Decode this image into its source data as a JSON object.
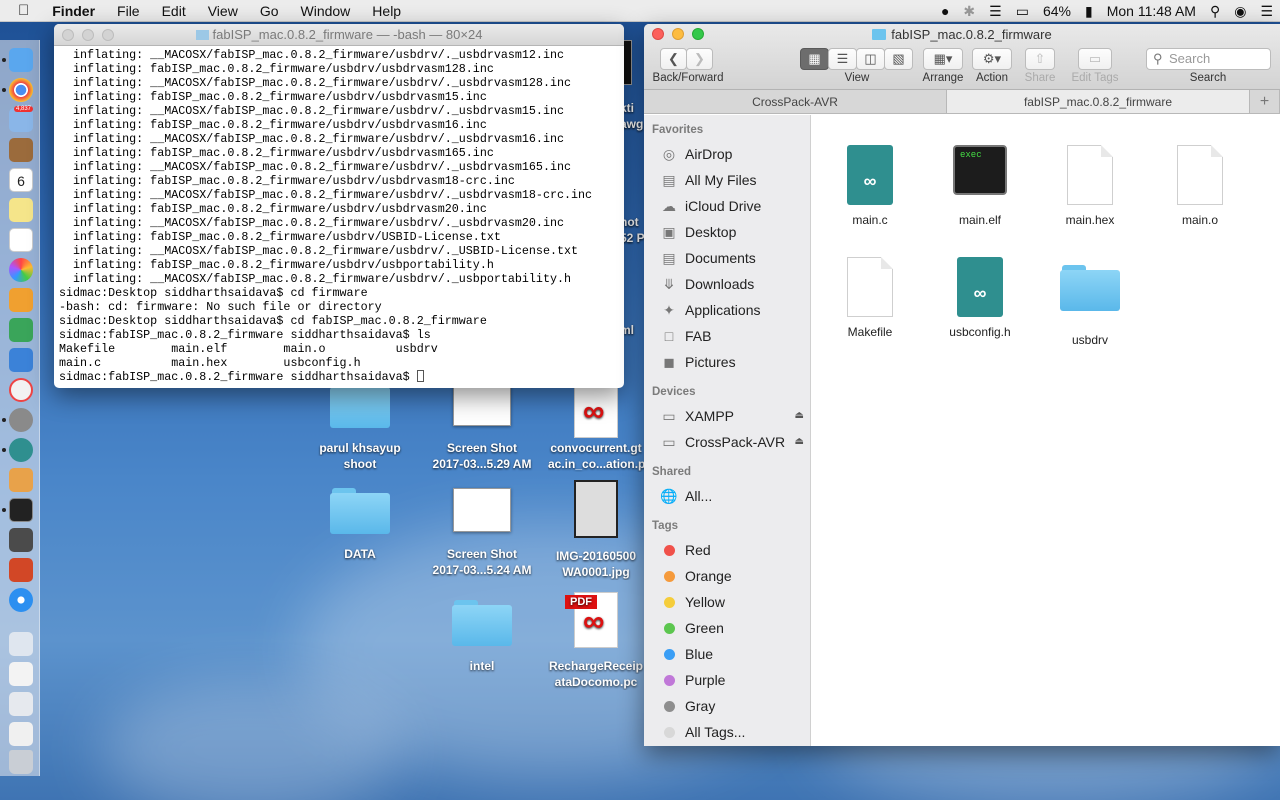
{
  "menubar": {
    "apple_icon": "apple-icon",
    "app": "Finder",
    "items": [
      "File",
      "Edit",
      "View",
      "Go",
      "Window",
      "Help"
    ],
    "battery": "64%",
    "clock": "Mon 11:48 AM"
  },
  "dock": {
    "badge": "4,837",
    "calendar_day": "6"
  },
  "desktop_icons": [
    {
      "label1": "parul khsayup",
      "label2": "shoot",
      "type": "folder"
    },
    {
      "label1": "Screen Shot",
      "label2": "2017-03...5.29 AM",
      "type": "screenshot"
    },
    {
      "label1": "convocurrent.gt",
      "label2": "ac.in_co...ation.p",
      "type": "pdf"
    },
    {
      "label1": "DATA",
      "label2": "",
      "type": "folder"
    },
    {
      "label1": "Screen Shot",
      "label2": "2017-03...5.24 AM",
      "type": "screenshot"
    },
    {
      "label1": "IMG-20160500",
      "label2": "WA0001.jpg",
      "type": "image"
    },
    {
      "label1": "intel",
      "label2": "",
      "type": "folder"
    },
    {
      "label1": "RechargeReceip",
      "label2": "ataDocomo.pc",
      "type": "pdf"
    }
  ],
  "partial_desktop_text": [
    "kti",
    "awg",
    "hot",
    "52 P",
    "ml"
  ],
  "terminal": {
    "title": "fabISP_mac.0.8.2_firmware — -bash — 80×24",
    "lines": [
      "  inflating: __MACOSX/fabISP_mac.0.8.2_firmware/usbdrv/._usbdrvasm12.inc",
      "  inflating: fabISP_mac.0.8.2_firmware/usbdrv/usbdrvasm128.inc",
      "  inflating: __MACOSX/fabISP_mac.0.8.2_firmware/usbdrv/._usbdrvasm128.inc",
      "  inflating: fabISP_mac.0.8.2_firmware/usbdrv/usbdrvasm15.inc",
      "  inflating: __MACOSX/fabISP_mac.0.8.2_firmware/usbdrv/._usbdrvasm15.inc",
      "  inflating: fabISP_mac.0.8.2_firmware/usbdrv/usbdrvasm16.inc",
      "  inflating: __MACOSX/fabISP_mac.0.8.2_firmware/usbdrv/._usbdrvasm16.inc",
      "  inflating: fabISP_mac.0.8.2_firmware/usbdrv/usbdrvasm165.inc",
      "  inflating: __MACOSX/fabISP_mac.0.8.2_firmware/usbdrv/._usbdrvasm165.inc",
      "  inflating: fabISP_mac.0.8.2_firmware/usbdrv/usbdrvasm18-crc.inc",
      "  inflating: __MACOSX/fabISP_mac.0.8.2_firmware/usbdrv/._usbdrvasm18-crc.inc",
      "  inflating: fabISP_mac.0.8.2_firmware/usbdrv/usbdrvasm20.inc",
      "  inflating: __MACOSX/fabISP_mac.0.8.2_firmware/usbdrv/._usbdrvasm20.inc",
      "  inflating: fabISP_mac.0.8.2_firmware/usbdrv/USBID-License.txt",
      "  inflating: __MACOSX/fabISP_mac.0.8.2_firmware/usbdrv/._USBID-License.txt",
      "  inflating: fabISP_mac.0.8.2_firmware/usbdrv/usbportability.h",
      "  inflating: __MACOSX/fabISP_mac.0.8.2_firmware/usbdrv/._usbportability.h",
      "sidmac:Desktop siddharthsaidava$ cd firmware",
      "-bash: cd: firmware: No such file or directory",
      "sidmac:Desktop siddharthsaidava$ cd fabISP_mac.0.8.2_firmware",
      "sidmac:fabISP_mac.0.8.2_firmware siddharthsaidava$ ls",
      "Makefile        main.elf        main.o          usbdrv",
      "main.c          main.hex        usbconfig.h"
    ],
    "prompt": "sidmac:fabISP_mac.0.8.2_firmware siddharthsaidava$ "
  },
  "finder": {
    "title": "fabISP_mac.0.8.2_firmware",
    "toolbar": {
      "back_forward": "Back/Forward",
      "view": "View",
      "arrange": "Arrange",
      "action": "Action",
      "share": "Share",
      "edit_tags": "Edit Tags",
      "search_placeholder": "Search",
      "search": "Search"
    },
    "tabs": [
      "CrossPack-AVR",
      "fabISP_mac.0.8.2_firmware"
    ],
    "sidebar": {
      "favorites_header": "Favorites",
      "favorites": [
        {
          "label": "AirDrop",
          "icon": "airdrop-icon"
        },
        {
          "label": "All My Files",
          "icon": "all-files-icon"
        },
        {
          "label": "iCloud Drive",
          "icon": "cloud-icon"
        },
        {
          "label": "Desktop",
          "icon": "desktop-icon"
        },
        {
          "label": "Documents",
          "icon": "documents-icon"
        },
        {
          "label": "Downloads",
          "icon": "downloads-icon"
        },
        {
          "label": "Applications",
          "icon": "applications-icon"
        },
        {
          "label": "FAB",
          "icon": "folder-icon"
        },
        {
          "label": "Pictures",
          "icon": "pictures-icon"
        }
      ],
      "devices_header": "Devices",
      "devices": [
        {
          "label": "XAMPP"
        },
        {
          "label": "CrossPack-AVR"
        }
      ],
      "shared_header": "Shared",
      "shared": [
        {
          "label": "All..."
        }
      ],
      "tags_header": "Tags",
      "tags": [
        {
          "label": "Red",
          "color": "#f0514a"
        },
        {
          "label": "Orange",
          "color": "#f59a3c"
        },
        {
          "label": "Yellow",
          "color": "#f5cd3b"
        },
        {
          "label": "Green",
          "color": "#5cc64f"
        },
        {
          "label": "Blue",
          "color": "#3a9ef5"
        },
        {
          "label": "Purple",
          "color": "#c078d8"
        },
        {
          "label": "Gray",
          "color": "#8e8e8e"
        },
        {
          "label": "All Tags...",
          "color": "#d8d8d8"
        }
      ]
    },
    "files": [
      {
        "name": "main.c",
        "kind": "arduino"
      },
      {
        "name": "main.elf",
        "kind": "exec",
        "badge": "exec"
      },
      {
        "name": "main.hex",
        "kind": "doc"
      },
      {
        "name": "main.o",
        "kind": "doc"
      },
      {
        "name": "Makefile",
        "kind": "doc"
      },
      {
        "name": "usbconfig.h",
        "kind": "arduino"
      },
      {
        "name": "usbdrv",
        "kind": "folder"
      }
    ]
  }
}
